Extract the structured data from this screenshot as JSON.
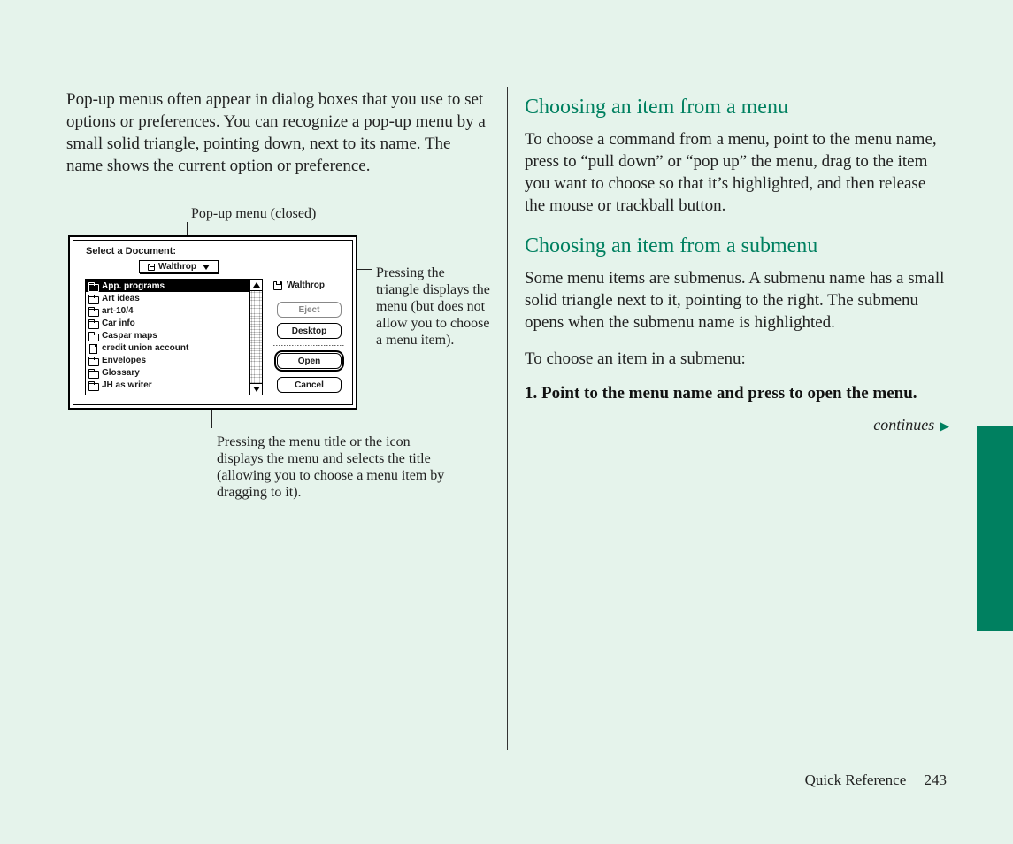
{
  "left": {
    "intro": "Pop-up menus often appear in dialog boxes that you use to set options or preferences. You can recognize a pop-up menu by a small solid triangle, pointing down, next to its name. The name shows the current option or preference.",
    "callout_top": "Pop-up menu (closed)",
    "callout_right": "Pressing the triangle displays the menu (but does not allow you to choose a menu item).",
    "callout_bottom": "Pressing the menu title or the icon displays the menu and selects the title (allowing you to choose a menu item by dragging to it)."
  },
  "dialog": {
    "title": "Select a Document:",
    "popup_value": "Walthrop",
    "disk_label": "Walthrop",
    "items": [
      {
        "kind": "folder",
        "label": "App. programs",
        "selected": true
      },
      {
        "kind": "folder",
        "label": "Art ideas"
      },
      {
        "kind": "folder",
        "label": "art-10/4"
      },
      {
        "kind": "folder",
        "label": "Car info"
      },
      {
        "kind": "folder",
        "label": "Caspar maps"
      },
      {
        "kind": "doc",
        "label": "credit union account"
      },
      {
        "kind": "folder",
        "label": "Envelopes"
      },
      {
        "kind": "folder",
        "label": "Glossary"
      },
      {
        "kind": "folder",
        "label": "JH as writer"
      }
    ],
    "buttons": {
      "eject": "Eject",
      "desktop": "Desktop",
      "open": "Open",
      "cancel": "Cancel"
    }
  },
  "right": {
    "h1": "Choosing an item from a menu",
    "p1": "To choose a command from a menu, point to the menu name, press to “pull down” or “pop up” the menu, drag to the item you want to choose so that it’s highlighted, and then release the mouse or trackball button.",
    "h2": "Choosing an item from a submenu",
    "p2": "Some menu items are submenus. A submenu name has a small solid triangle next to it, pointing to the right. The submenu opens when the submenu name is highlighted.",
    "p3": "To choose an item in a submenu:",
    "step1": "1.  Point to the menu name and press to open the menu.",
    "continues": "continues"
  },
  "footer": {
    "section": "Quick Reference",
    "page": "243"
  }
}
